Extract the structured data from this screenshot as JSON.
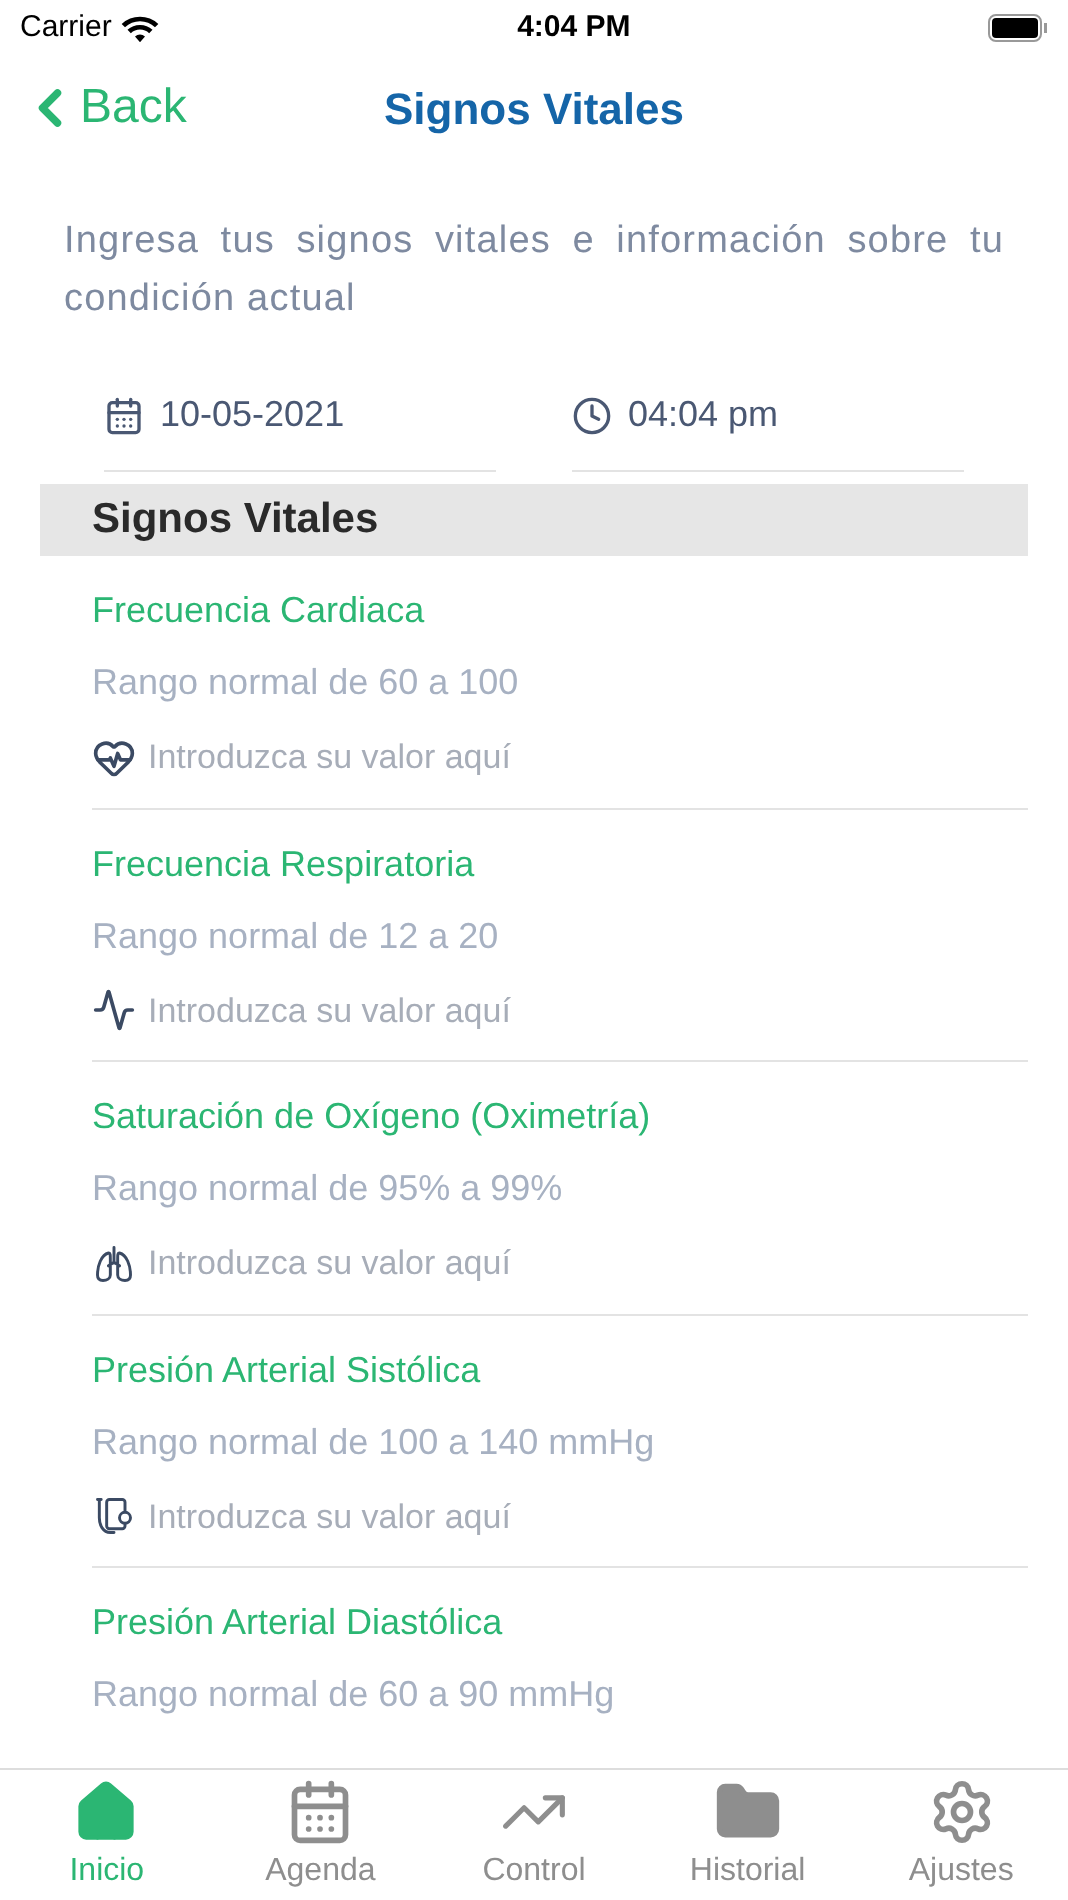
{
  "status_bar": {
    "carrier": "Carrier",
    "time": "4:04 PM"
  },
  "nav": {
    "back": "Back",
    "title": "Signos Vitales"
  },
  "description": "Ingresa tus signos vitales e información sobre tu condición actual",
  "date": "10-05-2021",
  "time": "04:04 pm",
  "section": "Signos Vitales",
  "vitals": [
    {
      "label": "Frecuencia Cardiaca",
      "range": "Rango normal de 60 a 100",
      "placeholder": "Introduzca su valor aquí"
    },
    {
      "label": "Frecuencia Respiratoria",
      "range": "Rango normal de 12 a 20",
      "placeholder": "Introduzca su valor aquí"
    },
    {
      "label": "Saturación de Oxígeno (Oximetría)",
      "range": "Rango normal de 95% a 99%",
      "placeholder": "Introduzca su valor aquí"
    },
    {
      "label": "Presión Arterial Sistólica",
      "range": "Rango normal de 100 a 140 mmHg",
      "placeholder": "Introduzca su valor aquí"
    },
    {
      "label": "Presión Arterial Diastólica",
      "range": "Rango normal de 60 a 90 mmHg"
    }
  ],
  "tabs": [
    {
      "label": "Inicio",
      "selected": true
    },
    {
      "label": "Agenda",
      "selected": false
    },
    {
      "label": "Control",
      "selected": false
    },
    {
      "label": "Historial",
      "selected": false
    },
    {
      "label": "Ajustes",
      "selected": false
    }
  ]
}
